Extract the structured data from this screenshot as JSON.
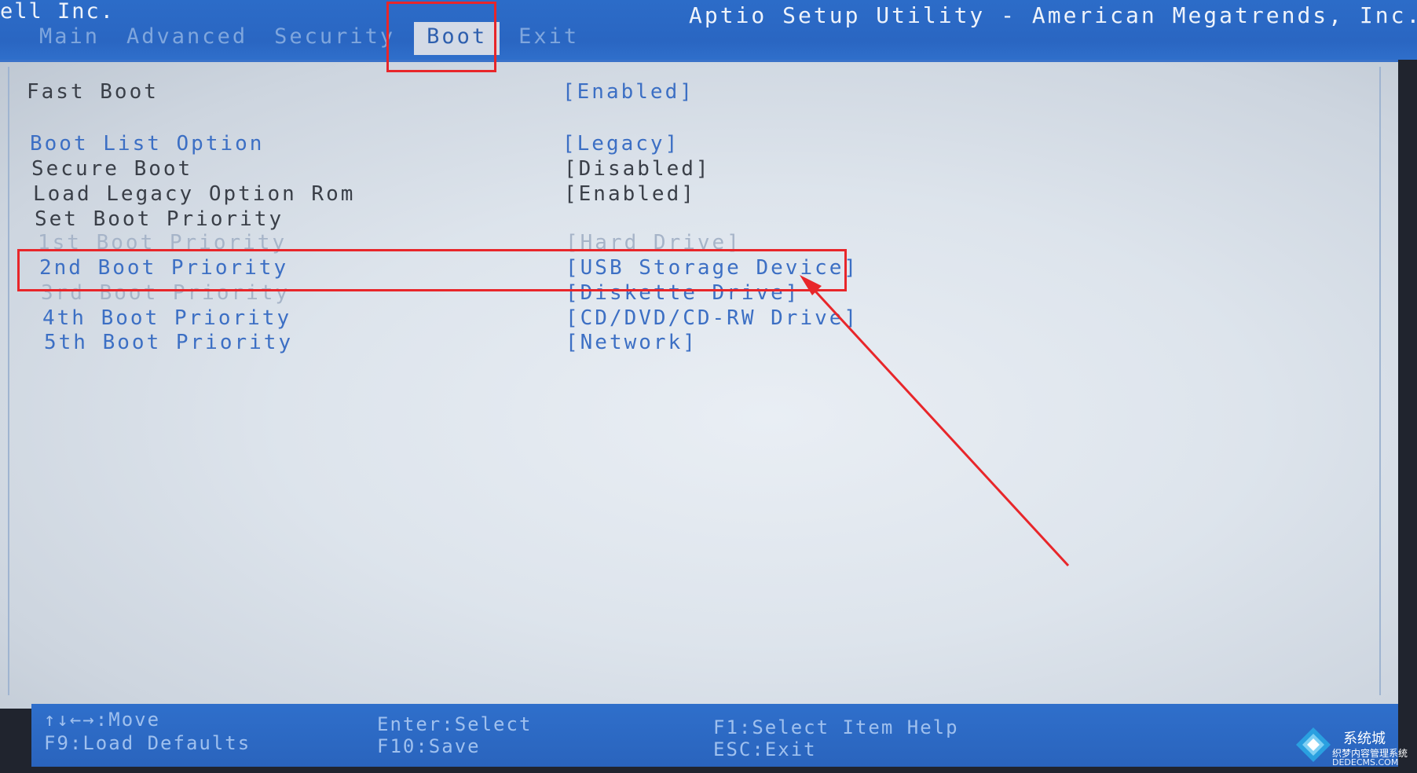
{
  "header": {
    "vendor": "ell Inc.",
    "utility_title": "Aptio Setup Utility - American Megatrends, Inc.",
    "tabs": [
      {
        "label": "Main",
        "active": false
      },
      {
        "label": "Advanced",
        "active": false
      },
      {
        "label": "Security",
        "active": false
      },
      {
        "label": "Boot",
        "active": true
      },
      {
        "label": "Exit",
        "active": false
      }
    ]
  },
  "settings": [
    {
      "label": "Fast Boot",
      "value": "[Enabled]"
    },
    {
      "label": "Boot List Option",
      "value": "[Legacy]"
    },
    {
      "label": "Secure Boot",
      "value": "[Disabled]"
    },
    {
      "label": "Load Legacy Option Rom",
      "value": "[Enabled]"
    },
    {
      "label": "Set Boot Priority",
      "value": ""
    },
    {
      "label": "1st Boot Priority",
      "value": "[Hard Drive]"
    },
    {
      "label": "2nd Boot Priority",
      "value": "[USB Storage Device]"
    },
    {
      "label": "3rd Boot Priority",
      "value": "[Diskette Drive]"
    },
    {
      "label": "4th Boot Priority",
      "value": "[CD/DVD/CD-RW Drive]"
    },
    {
      "label": "5th Boot Priority",
      "value": "[Network]"
    }
  ],
  "footer": {
    "move": "↑↓←→:Move",
    "load_defaults": "F9:Load Defaults",
    "enter_select": "Enter:Select",
    "save": "F10:Save",
    "item_help": "F1:Select Item Help",
    "exit": "ESC:Exit"
  },
  "watermark": {
    "brand": "系统城",
    "tagline": "织梦内容管理系统",
    "url": "DEDECMS.COM"
  },
  "colors": {
    "header_blue": "#2c6cc8",
    "panel_bg": "#dde4ec",
    "selected_text": "#3c6fc4",
    "annotation_red": "#e8262a"
  }
}
